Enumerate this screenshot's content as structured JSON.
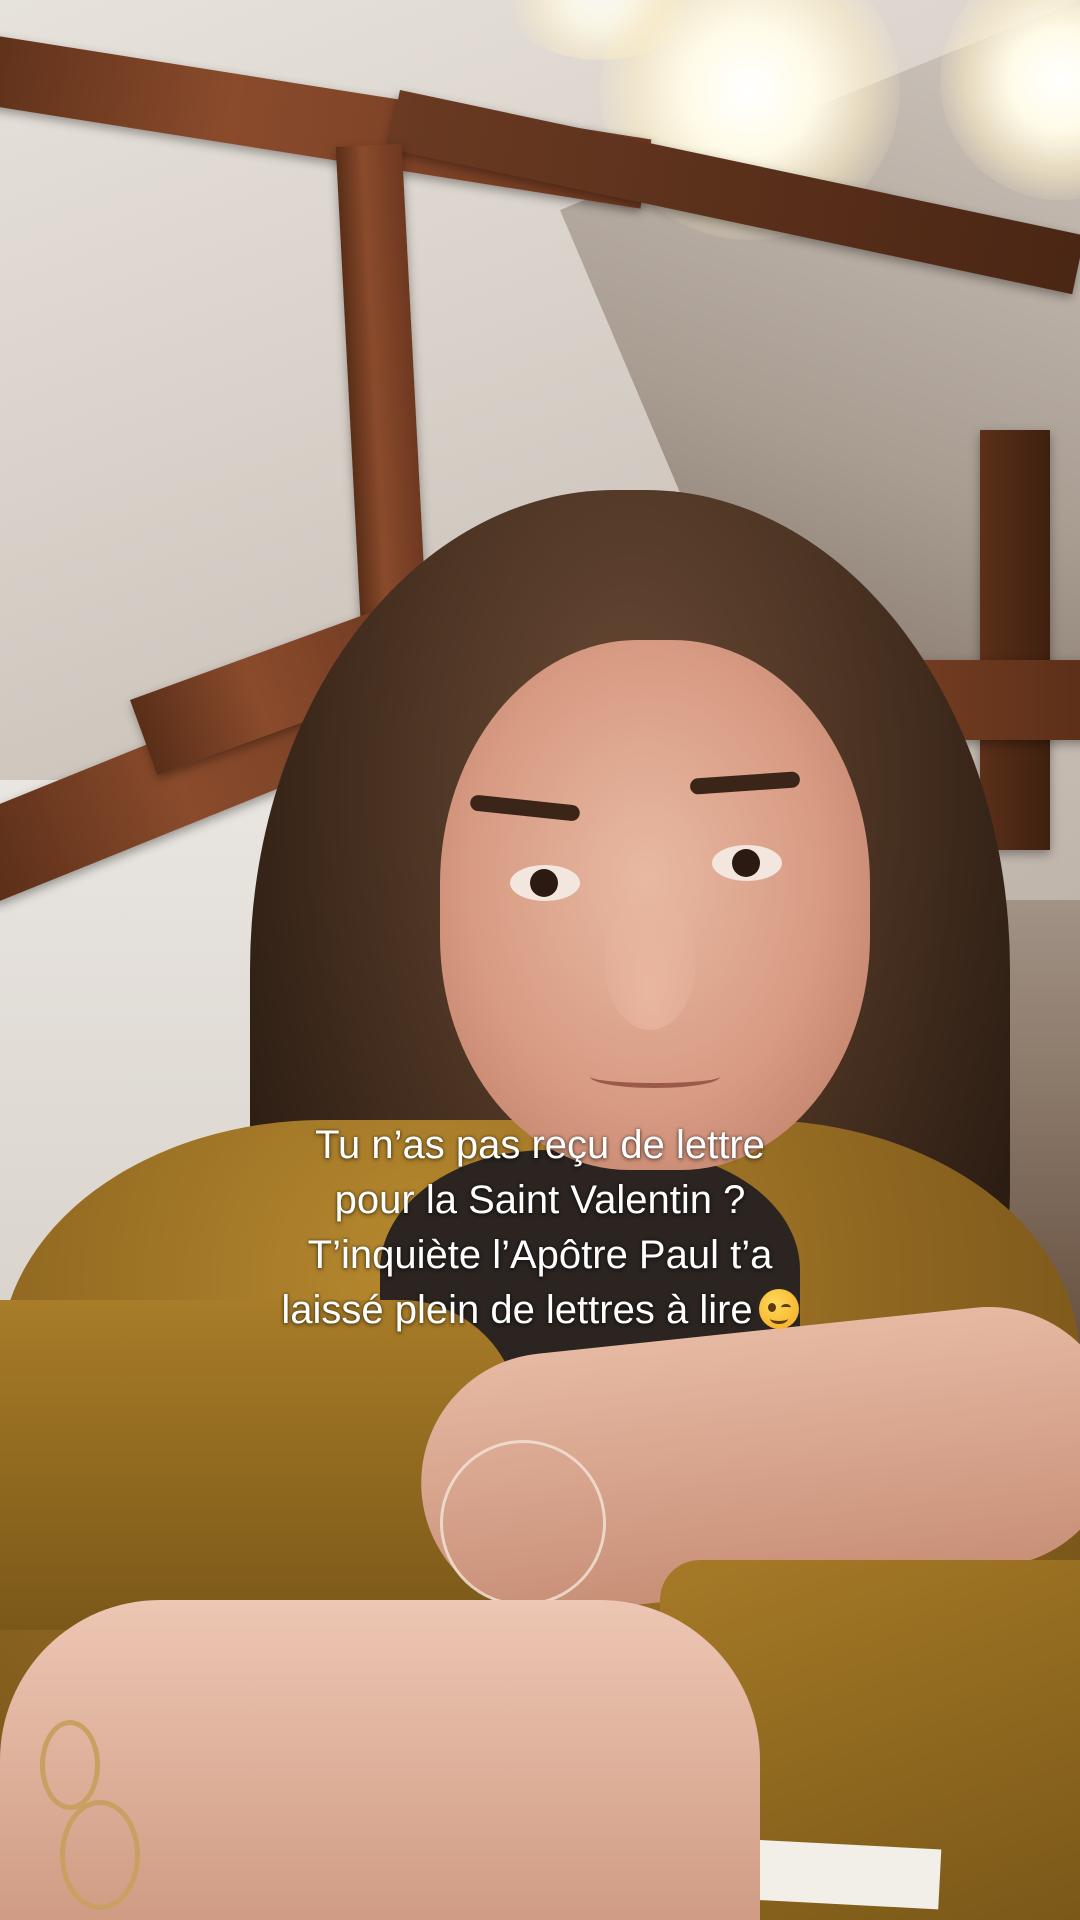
{
  "caption": {
    "line1": "Tu n’as pas reçu de lettre",
    "line2": "pour la Saint Valentin ?",
    "line3": "T’inquiète l’Apôtre Paul t’a",
    "line4": "laissé plein de lettres à lire",
    "emoji": "winking-face-emoji",
    "text_color": "#ffffff"
  },
  "scene": {
    "accent_jacket_color": "#8e6620",
    "beam_color": "#6e3820"
  }
}
